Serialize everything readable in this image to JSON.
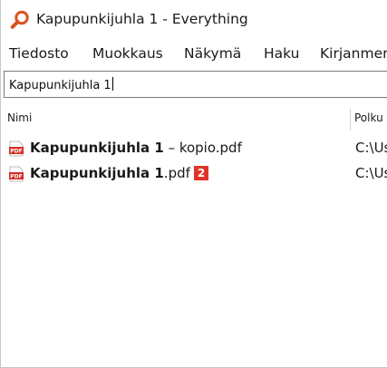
{
  "window": {
    "title": "Kapupunkijuhla 1 - Everything"
  },
  "menu": {
    "items": [
      "Tiedosto",
      "Muokkaus",
      "Näkymä",
      "Haku",
      "Kirjanmerkit"
    ]
  },
  "search": {
    "value": "Kapupunkijuhla 1"
  },
  "columns": {
    "name": "Nimi",
    "path": "Polku"
  },
  "results": [
    {
      "name_match": "Kapupunkijuhla 1",
      "name_rest": " – kopio.pdf",
      "path": "C:\\Users",
      "icon": "pdf-icon"
    },
    {
      "name_match": "Kapupunkijuhla 1",
      "name_rest": ".pdf",
      "path": "C:\\Users",
      "icon": "pdf-icon",
      "badge": "2"
    }
  ],
  "colors": {
    "badge": "#e0342c",
    "icon_accent": "#d9541e",
    "pdf_red": "#d62b23"
  }
}
